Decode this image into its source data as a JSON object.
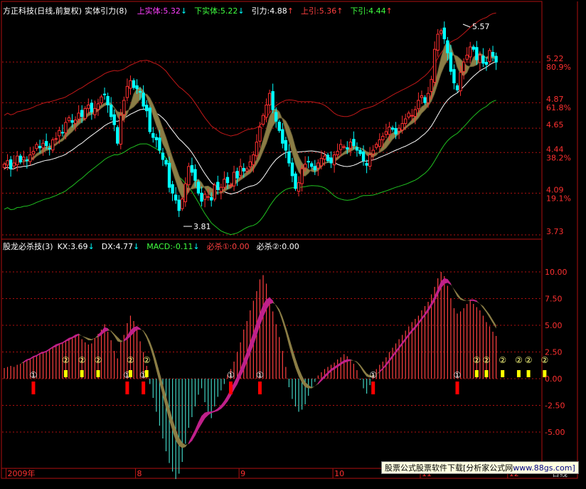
{
  "top_header": {
    "stock": "方正科技(日线,前复权)",
    "indicator": "实体引力(8)",
    "items": [
      {
        "label": "上实体:",
        "value": "5.32",
        "arrow": "↓",
        "color": "#ff40ff"
      },
      {
        "label": "下实体:",
        "value": "5.22",
        "arrow": "↓",
        "color": "#40ff40"
      },
      {
        "label": "引力:",
        "value": "4.88",
        "arrow": "↑",
        "color": "#ffffff"
      },
      {
        "label": "上引:",
        "value": "5.36",
        "arrow": "↑",
        "color": "#ff4040"
      },
      {
        "label": "下引:",
        "value": "4.44",
        "arrow": "↑",
        "color": "#40ff40"
      }
    ]
  },
  "bottom_header": {
    "indicator": "股龙必杀技(3)",
    "items": [
      {
        "label": "KX:",
        "value": "3.69",
        "arrow": "↓",
        "color": "#ffffff"
      },
      {
        "label": "DX:",
        "value": "4.77",
        "arrow": "↓",
        "color": "#ffffff"
      },
      {
        "label": "MACD:",
        "value": "-0.11",
        "arrow": "↓",
        "color": "#40ff40"
      },
      {
        "label": "必杀①:",
        "value": "0.00",
        "arrow": "",
        "color": "#ff4040"
      },
      {
        "label": "必杀②:",
        "value": "0.00",
        "arrow": "",
        "color": "#ffffff"
      }
    ]
  },
  "price_axis": {
    "labels": [
      {
        "value": 5.22,
        "text": "5.22",
        "pct": "80.9%"
      },
      {
        "value": 4.87,
        "text": "4.87",
        "pct": "61.8%"
      },
      {
        "value": 4.65,
        "text": "4.65",
        "pct": ""
      },
      {
        "value": 4.44,
        "text": "4.44",
        "pct": "38.2%"
      },
      {
        "value": 4.09,
        "text": "4.09",
        "pct": "19.1%"
      },
      {
        "value": 3.73,
        "text": "3.73",
        "pct": ""
      }
    ]
  },
  "price_annotations": {
    "high": "5.57",
    "low": "3.81"
  },
  "indicator_axis": {
    "labels": [
      "10.00",
      "7.50",
      "5.00",
      "2.50",
      "0.00",
      "-2.50",
      "-5.00"
    ]
  },
  "signal_labels": {
    "kill1": "①",
    "kill2": "②"
  },
  "date_axis": {
    "labels": [
      {
        "text": "2009年",
        "col": 1
      },
      {
        "text": "8",
        "col": 41
      },
      {
        "text": "9",
        "col": 73
      },
      {
        "text": "10",
        "col": 102
      },
      {
        "text": "11",
        "col": 129
      },
      {
        "text": "12",
        "col": 156
      }
    ],
    "period": "日线"
  },
  "watermark": {
    "text1": "股票公式股票软件下载[分析家公式网",
    "text2": "www.88gs.com]"
  },
  "colors": {
    "up_candle": "#ff3030",
    "down_candle": "#00ffff",
    "band_fill": "#8b7d45",
    "upper_band": "#c01818",
    "mid_line": "#ffffff",
    "lower_band": "#20c020",
    "grid_red": "#b01010",
    "macd_pos": "#ff4040",
    "macd_neg": "#40d0c0",
    "dx_fill_up": "#c0208a",
    "kill1_bar": "#ff0000",
    "kill2_bar": "#ffff00"
  },
  "chart_data": [
    {
      "type": "candlestick",
      "title": "方正科技(日线,前复权) 实体引力(8)",
      "ylim": [
        3.73,
        5.62
      ],
      "closes": [
        4.34,
        4.37,
        4.3,
        4.35,
        4.41,
        4.36,
        4.4,
        4.37,
        4.42,
        4.45,
        4.51,
        4.48,
        4.52,
        4.5,
        4.47,
        4.55,
        4.56,
        4.63,
        4.61,
        4.7,
        4.74,
        4.7,
        4.72,
        4.78,
        4.75,
        4.82,
        4.85,
        4.79,
        4.82,
        4.86,
        4.92,
        4.94,
        4.85,
        4.75,
        4.68,
        4.52,
        4.76,
        4.89,
        5.01,
        5.06,
        5.0,
        4.99,
        4.96,
        4.84,
        4.8,
        4.62,
        4.57,
        4.55,
        4.46,
        4.38,
        4.34,
        4.14,
        4.09,
        4.03,
        3.94,
        4.04,
        4.17,
        4.32,
        4.27,
        4.2,
        4.09,
        4.02,
        4.08,
        4.06,
        4.03,
        4.16,
        4.12,
        4.14,
        4.21,
        4.18,
        4.16,
        4.27,
        4.22,
        4.32,
        4.28,
        4.3,
        4.36,
        4.42,
        4.53,
        4.66,
        4.76,
        4.85,
        4.95,
        4.81,
        4.71,
        4.63,
        4.52,
        4.46,
        4.35,
        4.24,
        4.13,
        4.18,
        4.3,
        4.34,
        4.36,
        4.32,
        4.29,
        4.35,
        4.39,
        4.41,
        4.37,
        4.35,
        4.42,
        4.45,
        4.51,
        4.49,
        4.47,
        4.53,
        4.5,
        4.46,
        4.43,
        4.37,
        4.33,
        4.42,
        4.46,
        4.51,
        4.55,
        4.58,
        4.62,
        4.66,
        4.64,
        4.6,
        4.65,
        4.69,
        4.73,
        4.78,
        4.76,
        4.81,
        4.89,
        4.93,
        4.87,
        4.95,
        5.07,
        5.33,
        5.46,
        5.49,
        5.42,
        5.3,
        5.14,
        5.04,
        4.98,
        5.13,
        5.22,
        5.28,
        5.35,
        5.33,
        5.24,
        5.28,
        5.21,
        5.2,
        5.32,
        5.27,
        5.22
      ],
      "ma_band_upper": 5.36,
      "ma_band_lower": 4.44
    },
    {
      "type": "bar",
      "title": "股龙必杀技(3)",
      "ylim": [
        -8,
        12
      ],
      "macd": [
        1.0,
        1.1,
        1.2,
        1.1,
        1.3,
        1.4,
        1.6,
        1.8,
        1.9,
        2.1,
        2.2,
        2.4,
        2.5,
        2.6,
        2.8,
        3.0,
        3.2,
        3.3,
        3.4,
        3.6,
        3.8,
        3.9,
        4.1,
        4.2,
        3.7,
        3.4,
        3.2,
        3.3,
        3.8,
        4.2,
        4.6,
        5.1,
        4.4,
        3.6,
        2.6,
        1.9,
        3.4,
        4.1,
        5.2,
        5.9,
        5.4,
        4.6,
        3.5,
        2.5,
        1.2,
        -0.5,
        -1.8,
        -3.1,
        -4.4,
        -5.6,
        -6.8,
        -7.9,
        -8.7,
        -9.4,
        -8.9,
        -7.8,
        -6.1,
        -4.6,
        -3.6,
        -2.6,
        -1.5,
        -0.9,
        -2.2,
        -3.1,
        -3.7,
        -2.6,
        -1.7,
        -1.1,
        -0.5,
        0.4,
        0.9,
        1.6,
        2.5,
        3.4,
        4.6,
        5.4,
        6.4,
        7.3,
        8.2,
        9.3,
        9.7,
        8.9,
        7.6,
        6.3,
        5.1,
        3.9,
        2.6,
        1.1,
        -0.8,
        -1.9,
        -2.6,
        -3.1,
        -2.9,
        -2.4,
        -1.6,
        -0.9,
        -0.3,
        0.3,
        0.6,
        0.9,
        1.1,
        1.3,
        1.5,
        1.8,
        2.0,
        2.3,
        2.1,
        1.8,
        1.4,
        0.8,
        -0.1,
        -0.9,
        -1.4,
        -0.6,
        0.4,
        0.9,
        1.3,
        1.6,
        2.0,
        2.5,
        2.9,
        3.3,
        3.7,
        4.1,
        4.5,
        4.9,
        5.3,
        5.6,
        5.9,
        6.4,
        6.8,
        7.2,
        7.9,
        8.6,
        9.4,
        10.0,
        9.6,
        8.7,
        7.5,
        6.6,
        6.1,
        6.3,
        6.6,
        7.0,
        7.3,
        7.0,
        6.7,
        6.4,
        5.9,
        5.3,
        4.9,
        4.4,
        4.0
      ],
      "kx": [
        1.0,
        1.1,
        1.2,
        1.2,
        1.3,
        1.4,
        1.6,
        1.8,
        1.9,
        2.1,
        2.2,
        2.4,
        2.5,
        2.6,
        2.8,
        3.0,
        3.2,
        3.3,
        3.4,
        3.6,
        3.8,
        3.9,
        4.1,
        4.2,
        4.0,
        3.8,
        3.6,
        3.6,
        3.8,
        4.1,
        4.4,
        4.8,
        4.7,
        4.4,
        4.0,
        3.5,
        3.4,
        3.6,
        4.0,
        4.5,
        4.8,
        4.9,
        4.7,
        4.4,
        3.8,
        3.0,
        2.0,
        0.8,
        -0.4,
        -1.6,
        -2.8,
        -3.9,
        -4.9,
        -5.8,
        -6.3,
        -6.5,
        -6.4,
        -6.0,
        -5.4,
        -4.8,
        -4.1,
        -3.5,
        -3.2,
        -3.1,
        -3.1,
        -3.0,
        -2.8,
        -2.5,
        -2.1,
        -1.6,
        -1.0,
        -0.4,
        0.2,
        0.9,
        1.7,
        2.5,
        3.4,
        4.3,
        5.2,
        6.1,
        6.9,
        7.4,
        7.6,
        7.3,
        6.8,
        6.2,
        5.3,
        4.3,
        3.1,
        2.0,
        1.0,
        0.2,
        -0.4,
        -0.8,
        -0.9,
        -0.9,
        -0.7,
        -0.4,
        0.0,
        0.3,
        0.6,
        0.9,
        1.1,
        1.3,
        1.5,
        1.7,
        1.8,
        1.8,
        1.7,
        1.5,
        1.1,
        0.6,
        0.2,
        0.1,
        0.2,
        0.4,
        0.7,
        1.0,
        1.4,
        1.8,
        2.2,
        2.6,
        3.0,
        3.4,
        3.8,
        4.2,
        4.6,
        4.9,
        5.3,
        5.7,
        6.1,
        6.6,
        7.1,
        7.7,
        8.4,
        9.1,
        9.4,
        9.3,
        8.9,
        8.3,
        7.7,
        7.4,
        7.3,
        7.3,
        7.4,
        7.4,
        7.3,
        7.0,
        6.6,
        6.2,
        5.7,
        5.2,
        4.7
      ],
      "dx": [
        1.0,
        1.1,
        1.2,
        1.2,
        1.3,
        1.4,
        1.5,
        1.7,
        1.8,
        2.0,
        2.1,
        2.3,
        2.4,
        2.5,
        2.7,
        2.9,
        3.0,
        3.2,
        3.3,
        3.5,
        3.6,
        3.8,
        3.9,
        4.1,
        4.0,
        3.9,
        3.8,
        3.7,
        3.8,
        3.9,
        4.1,
        4.4,
        4.5,
        4.5,
        4.2,
        3.9,
        3.6,
        3.5,
        3.7,
        4.0,
        4.3,
        4.6,
        4.6,
        4.5,
        4.1,
        3.5,
        2.7,
        1.7,
        0.6,
        -0.5,
        -1.6,
        -2.7,
        -3.8,
        -4.7,
        -5.5,
        -6.0,
        -6.2,
        -6.1,
        -5.8,
        -5.3,
        -4.7,
        -4.2,
        -3.7,
        -3.4,
        -3.2,
        -3.1,
        -3.0,
        -2.8,
        -2.5,
        -2.1,
        -1.6,
        -1.0,
        -0.5,
        0.2,
        0.8,
        1.6,
        2.4,
        3.2,
        4.1,
        5.0,
        5.8,
        6.5,
        7.0,
        7.1,
        6.9,
        6.5,
        5.8,
        4.9,
        3.9,
        2.9,
        1.9,
        1.0,
        0.3,
        -0.3,
        -0.6,
        -0.8,
        -0.7,
        -0.5,
        -0.2,
        0.1,
        0.4,
        0.7,
        0.9,
        1.1,
        1.3,
        1.5,
        1.6,
        1.7,
        1.7,
        1.6,
        1.3,
        0.9,
        0.5,
        0.3,
        0.3,
        0.4,
        0.6,
        0.9,
        1.2,
        1.6,
        2.0,
        2.4,
        2.8,
        3.2,
        3.6,
        4.0,
        4.4,
        4.7,
        5.1,
        5.5,
        5.9,
        6.3,
        6.8,
        7.3,
        7.9,
        8.5,
        8.9,
        9.0,
        8.8,
        8.4,
        8.0,
        7.6,
        7.4,
        7.3,
        7.3,
        7.3,
        7.2,
        7.0,
        6.8,
        6.4,
        6.0,
        5.5,
        5.0
      ],
      "kill1_index": [
        9,
        38,
        43,
        70,
        79,
        114,
        140
      ],
      "kill2_index": [
        19,
        24,
        29,
        39,
        44,
        146,
        149,
        154,
        159,
        162,
        167
      ]
    }
  ]
}
